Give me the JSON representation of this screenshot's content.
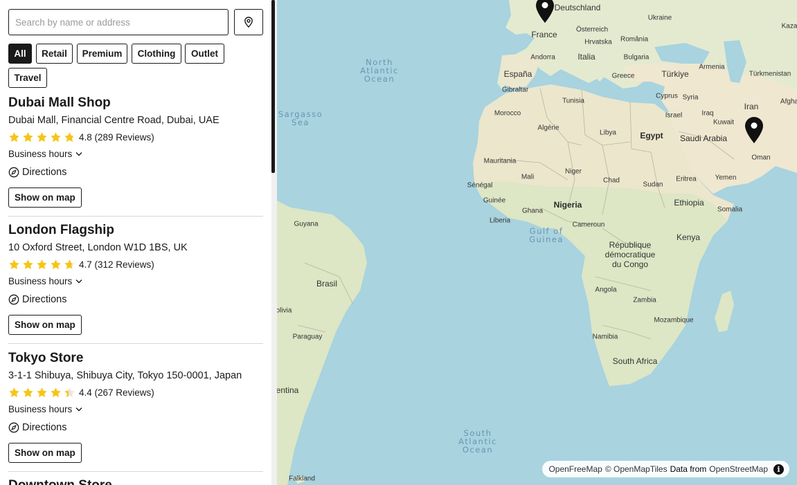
{
  "search": {
    "placeholder": "Search by name or address"
  },
  "filters": [
    {
      "label": "All",
      "active": true
    },
    {
      "label": "Retail",
      "active": false
    },
    {
      "label": "Premium",
      "active": false
    },
    {
      "label": "Clothing",
      "active": false
    },
    {
      "label": "Outlet",
      "active": false
    },
    {
      "label": "Travel",
      "active": false
    }
  ],
  "stores": [
    {
      "name": "Dubai Mall Shop",
      "address": "Dubai Mall, Financial Centre Road, Dubai, UAE",
      "rating": 4.8,
      "rating_text": "4.8 (289 Reviews)",
      "hours_label": "Business hours",
      "directions_label": "Directions",
      "show_on_map_label": "Show on map"
    },
    {
      "name": "London Flagship",
      "address": "10 Oxford Street, London W1D 1BS, UK",
      "rating": 4.7,
      "rating_text": "4.7 (312 Reviews)",
      "hours_label": "Business hours",
      "directions_label": "Directions",
      "show_on_map_label": "Show on map"
    },
    {
      "name": "Tokyo Store",
      "address": "3-1-1 Shibuya, Shibuya City, Tokyo 150-0001, Japan",
      "rating": 4.4,
      "rating_text": "4.4 (267 Reviews)",
      "hours_label": "Business hours",
      "directions_label": "Directions",
      "show_on_map_label": "Show on map"
    },
    {
      "name": "Downtown Store",
      "address": "",
      "rating": null,
      "rating_text": "",
      "hours_label": "",
      "directions_label": "",
      "show_on_map_label": ""
    }
  ],
  "map": {
    "labels": {
      "deutschland": "Deutschland",
      "ukraine": "Ukraine",
      "kaza": "Kaza",
      "france": "France",
      "osterreich": "Österreich",
      "romania": "România",
      "hrvatska": "Hrvatska",
      "italia": "Italia",
      "bulgaria": "Bulgaria",
      "andorra": "Andorra",
      "espana": "España",
      "greece": "Greece",
      "turkiye": "Türkiye",
      "armenia": "Armenia",
      "turkmenistan": "Türkmenistan",
      "gibraltar": "Gibraltar",
      "cyprus": "Cyprus",
      "syria": "Syria",
      "iran": "Iran",
      "afgha": "Afgha",
      "tunisia": "Tunisia",
      "morocco": "Morocco",
      "israel": "Israel",
      "iraq": "Iraq",
      "algerie": "Algérie",
      "libya": "Libya",
      "egypt": "Egypt",
      "kuwait": "Kuwait",
      "saudi": "Saudi Arabia",
      "oman": "Oman",
      "mauritania": "Mauritania",
      "mali": "Mali",
      "niger": "Niger",
      "senegal": "Sénégal",
      "chad": "Chad",
      "sudan": "Sudan",
      "eritrea": "Eritrea",
      "yemen": "Yemen",
      "guinee": "Guinée",
      "nigeria": "Nigeria",
      "ethiopia": "Ethiopia",
      "somalia": "Somalia",
      "ghana": "Ghana",
      "liberia": "Liberia",
      "cameroun": "Cameroun",
      "guyana": "Guyana",
      "kenya": "Kenya",
      "rdc1": "République",
      "rdc2": "démocratique",
      "rdc3": "du Congo",
      "brasil": "Brasil",
      "angola": "Angola",
      "zambia": "Zambia",
      "olivia": "olivia",
      "mozambique": "Mozambique",
      "paraguay": "Paraguay",
      "namibia": "Namibia",
      "south_africa": "South Africa",
      "entina": "entina",
      "falkland": "Falkland",
      "north_atlantic": [
        "North",
        "Atlantic",
        "Ocean"
      ],
      "sargasso": [
        "Sargasso",
        "Sea"
      ],
      "gulf_guinea": [
        "Gulf of",
        "Guinea"
      ],
      "south_atlantic": [
        "South",
        "Atlantic",
        "Ocean"
      ]
    },
    "attribution": {
      "openfreemap": "OpenFreeMap",
      "openmaptiles": "© OpenMapTiles",
      "data_from": "Data from",
      "osm": "OpenStreetMap"
    }
  },
  "colors": {
    "water": "#a8d3df",
    "land": "#eae9d9",
    "desert": "#efe8d2",
    "green": "#d8e6c4",
    "star": "#f5c518",
    "star_empty": "#e8e6dd",
    "ink": "#1a1a1a"
  }
}
